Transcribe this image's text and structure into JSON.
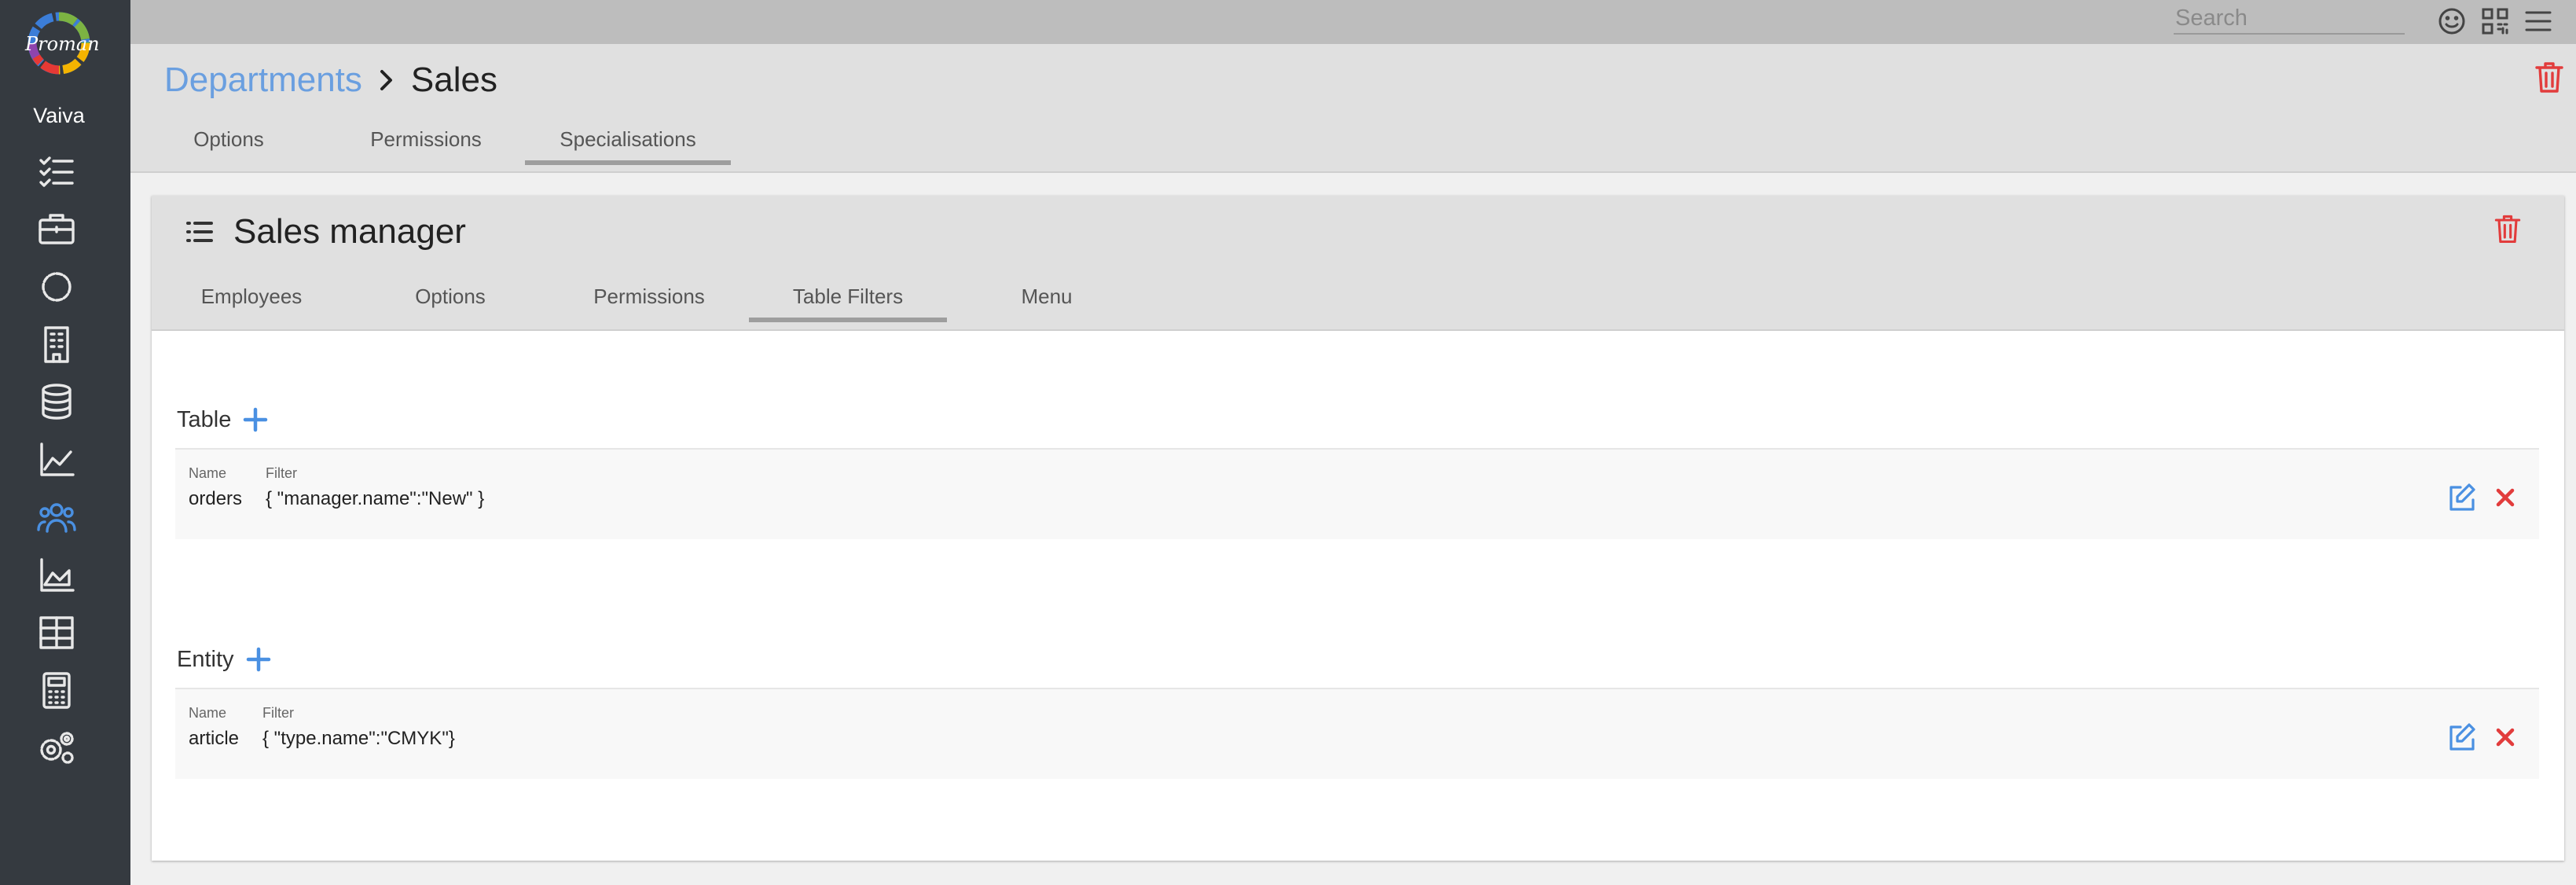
{
  "app": {
    "logo_text": "Proman",
    "user_name": "Vaiva"
  },
  "sidebar": {
    "items": [
      {
        "icon": "task-list-icon"
      },
      {
        "icon": "briefcase-icon"
      },
      {
        "icon": "gear-outline-icon"
      },
      {
        "icon": "building-icon"
      },
      {
        "icon": "database-icon"
      },
      {
        "icon": "line-chart-icon"
      },
      {
        "icon": "users-icon",
        "active": true
      },
      {
        "icon": "area-chart-icon"
      },
      {
        "icon": "table-icon"
      },
      {
        "icon": "calculator-icon"
      },
      {
        "icon": "settings-icon"
      }
    ]
  },
  "topbar": {
    "search_placeholder": "Search",
    "icons": [
      "smiley-icon",
      "qr-code-icon",
      "menu-icon"
    ]
  },
  "header": {
    "breadcrumb_parent": "Departments",
    "breadcrumb_current": "Sales",
    "tabs": [
      {
        "label": "Options"
      },
      {
        "label": "Permissions"
      },
      {
        "label": "Specialisations",
        "active": true
      }
    ]
  },
  "card": {
    "title": "Sales manager",
    "tabs": [
      {
        "label": "Employees"
      },
      {
        "label": "Options"
      },
      {
        "label": "Permissions"
      },
      {
        "label": "Table Filters",
        "active": true
      },
      {
        "label": "Menu"
      }
    ],
    "sections": [
      {
        "title": "Table",
        "name_label": "Name",
        "filter_label": "Filter",
        "name": "orders",
        "filter": "{ \"manager.name\":\"New\" }"
      },
      {
        "title": "Entity",
        "name_label": "Name",
        "filter_label": "Filter",
        "name": "article",
        "filter": "{ \"type.name\":\"CMYK\"}"
      }
    ]
  },
  "colors": {
    "sidebar_bg": "#353a40",
    "accent": "#4a90e2",
    "danger": "#e23c3c",
    "header_bg": "#e0e0e0"
  }
}
